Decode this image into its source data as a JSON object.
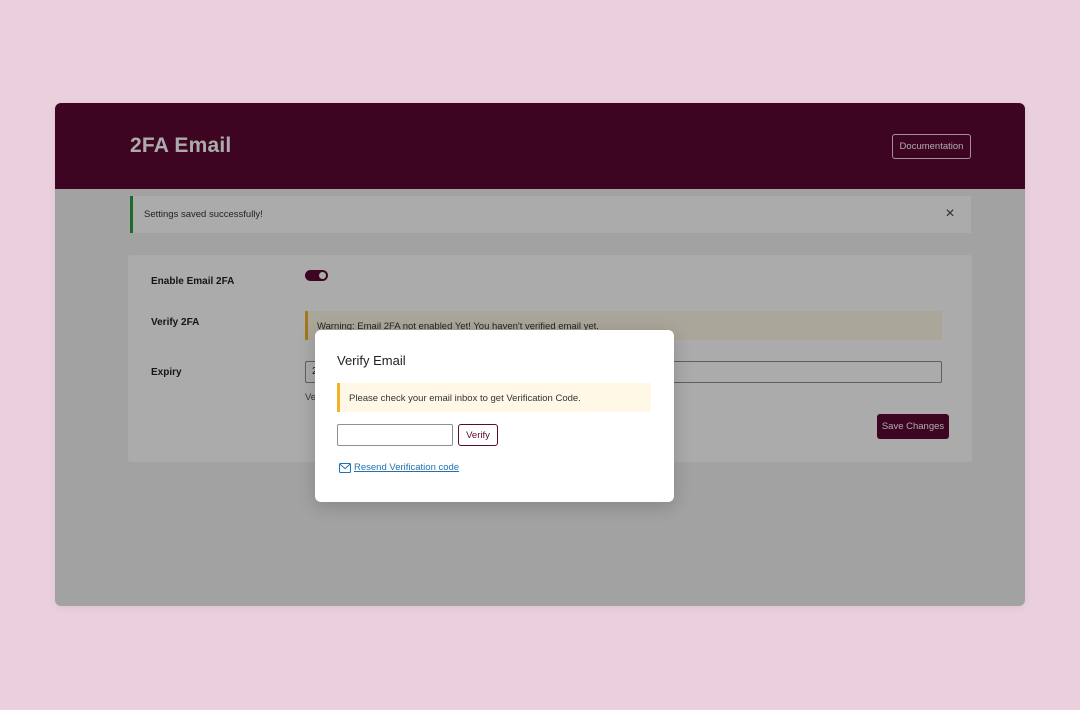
{
  "header": {
    "title": "2FA Email",
    "documentation_label": "Documentation"
  },
  "notice": {
    "text": "Settings saved successfully!",
    "close_icon": "×"
  },
  "settings": {
    "enable_label": "Enable Email 2FA",
    "enable_on": true,
    "verify_label": "Verify 2FA",
    "warning_text": "Warning: Email 2FA not enabled Yet! You haven't verified email yet.",
    "expiry_label": "Expiry",
    "expiry_value": "2",
    "expiry_help": "Ve",
    "save_label": "Save Changes"
  },
  "modal": {
    "title": "Verify Email",
    "info_text": "Please check your email inbox to get Verification Code.",
    "code_value": "",
    "verify_label": "Verify",
    "resend_label": "Resend Verification code"
  },
  "colors": {
    "brand": "#5c0832",
    "success": "#2e9e44",
    "warning": "#f0b429",
    "link": "#2271b1",
    "background": "#ead0dc"
  }
}
